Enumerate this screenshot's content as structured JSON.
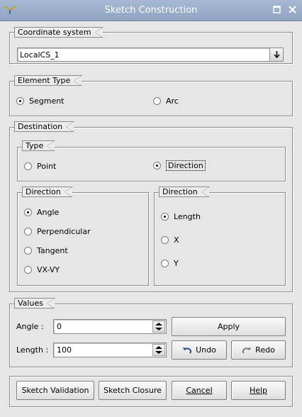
{
  "window": {
    "title": "Sketch Construction",
    "icon": "app-arrow-icon",
    "controls": [
      "maximize-icon",
      "close-icon"
    ]
  },
  "coordinate_system": {
    "legend": "Coordinate system",
    "selected": "LocalCS_1"
  },
  "element_type": {
    "legend": "Element Type",
    "options": [
      {
        "label": "Segment",
        "checked": true
      },
      {
        "label": "Arc",
        "checked": false
      }
    ]
  },
  "destination": {
    "legend": "Destination",
    "type": {
      "legend": "Type",
      "options": [
        {
          "label": "Point",
          "checked": false
        },
        {
          "label": "Direction",
          "checked": true
        }
      ]
    },
    "direction_left": {
      "legend": "Direction",
      "options": [
        {
          "label": "Angle",
          "checked": true
        },
        {
          "label": "Perpendicular",
          "checked": false
        },
        {
          "label": "Tangent",
          "checked": false
        },
        {
          "label": "VX-VY",
          "checked": false
        }
      ]
    },
    "direction_right": {
      "legend": "Direction",
      "options": [
        {
          "label": "Length",
          "checked": true
        },
        {
          "label": "X",
          "checked": false
        },
        {
          "label": "Y",
          "checked": false
        }
      ]
    }
  },
  "values": {
    "legend": "Values",
    "angle_label": "Angle :",
    "angle_value": "0",
    "length_label": "Length :",
    "length_value": "100",
    "apply": "Apply",
    "undo": "Undo",
    "redo": "Redo"
  },
  "footer": {
    "validation": "Sketch Validation",
    "closure": "Sketch Closure",
    "cancel": "Cancel",
    "help": "Help"
  }
}
